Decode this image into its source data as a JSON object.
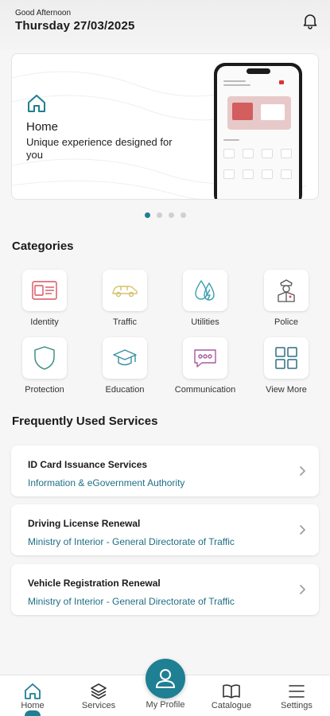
{
  "header": {
    "greeting": "Good Afternoon",
    "date": "Thursday 27/03/2025",
    "notification_icon": "bell-icon"
  },
  "banner": {
    "icon": "home-icon",
    "title": "Home",
    "subtitle": "Unique experience designed for you",
    "carousel_pages": 4,
    "carousel_active_index": 0
  },
  "categories": {
    "title": "Categories",
    "items": [
      {
        "label": "Identity",
        "icon": "id-card-icon"
      },
      {
        "label": "Traffic",
        "icon": "car-icon"
      },
      {
        "label": "Utilities",
        "icon": "utilities-icon"
      },
      {
        "label": "Police",
        "icon": "police-icon"
      },
      {
        "label": "Protection",
        "icon": "shield-icon"
      },
      {
        "label": "Education",
        "icon": "graduation-cap-icon"
      },
      {
        "label": "Communication",
        "icon": "chat-icon"
      },
      {
        "label": "View More",
        "icon": "grid-icon"
      }
    ]
  },
  "services": {
    "title": "Frequently Used Services",
    "items": [
      {
        "title": "ID Card Issuance Services",
        "provider": "Information & eGovernment Authority"
      },
      {
        "title": "Driving License Renewal",
        "provider": "Ministry of Interior - General Directorate of Traffic"
      },
      {
        "title": "Vehicle Registration Renewal",
        "provider": "Ministry of Interior - General Directorate of Traffic"
      }
    ]
  },
  "bottom_nav": {
    "items": [
      {
        "label": "Home",
        "icon": "home-icon"
      },
      {
        "label": "Services",
        "icon": "layers-icon"
      },
      {
        "label": "My Profile",
        "icon": "user-icon"
      },
      {
        "label": "Catalogue",
        "icon": "book-icon"
      },
      {
        "label": "Settings",
        "icon": "menu-icon"
      }
    ],
    "active": "Home"
  },
  "colors": {
    "accent": "#1f7f93",
    "link": "#1f6f86",
    "identity": "#d9535f",
    "traffic": "#d4c36a",
    "utilities": "#3a9fb0",
    "police": "#555555",
    "protection": "#2e8b7a",
    "education": "#3a8ea0",
    "communication": "#a85a9c",
    "view_more": "#2f6f82"
  }
}
